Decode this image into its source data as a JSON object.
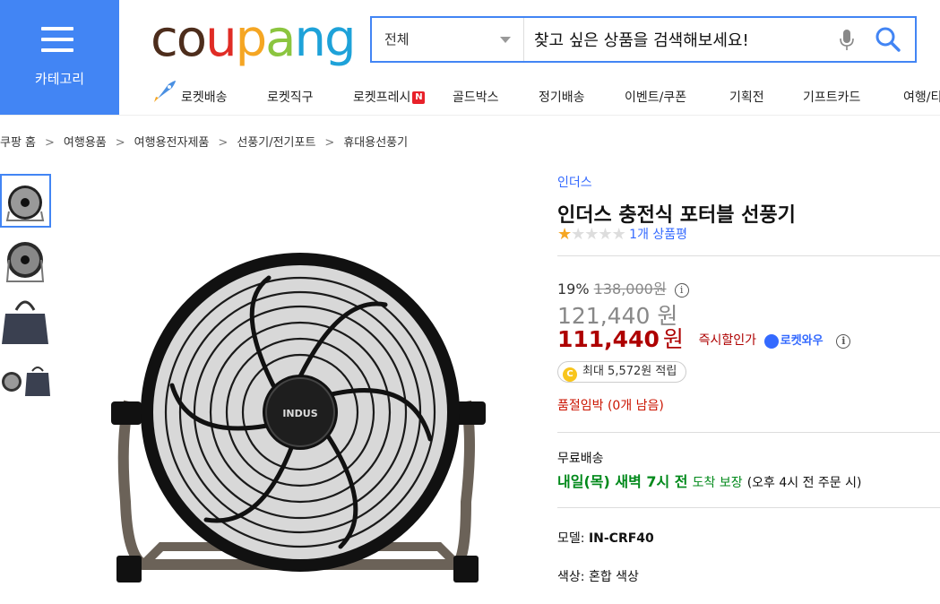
{
  "header": {
    "category_label": "카테고리",
    "logo_letters": [
      "c",
      "o",
      "u",
      "p",
      "a",
      "n",
      "g"
    ],
    "logo_colors": [
      "#4d2d1c",
      "#4d2d1c",
      "#e02c25",
      "#f5a623",
      "#8bc53f",
      "#1ea2d9",
      "#1ea2d9"
    ],
    "search": {
      "category": "전체",
      "placeholder": "찾고 싶은 상품을 검색해보세요!"
    }
  },
  "nav": {
    "items": [
      "로켓배송",
      "로켓직구",
      "로켓프레시",
      "골드박스",
      "정기배송",
      "이벤트/쿠폰",
      "기획전",
      "기프트카드",
      "여행/티"
    ],
    "fresh_badge": "N"
  },
  "breadcrumb": [
    "쿠팡 홈",
    "여행용품",
    "여행용전자제품",
    "선풍기/전기포트",
    "휴대용선풍기"
  ],
  "breadcrumb_sep": ">",
  "product": {
    "brand": "인더스",
    "title": "인더스 충전식 포터블 선풍기",
    "rating_stars": 1,
    "rating_max": 5,
    "review_text": "1개 상품평",
    "discount_rate": "19%",
    "original_price": "138,000원",
    "sale_price_value": "121,440",
    "sale_price_unit": "원",
    "instant_price_value": "111,440",
    "instant_price_unit": "원",
    "instant_label": "즉시할인가",
    "rocket_wow": "로켓와우",
    "reward_coin": "C",
    "reward_text": "최대 5,572원 적립",
    "stock_text": "품절임박 (0개 남음)",
    "shipping_label": "무료배송",
    "shipping_date": "내일(목) 새벽 7시 전",
    "shipping_guarantee": "도착 보장",
    "shipping_condition": "(오후 4시 전 주문 시)",
    "model_label": "모델:",
    "model_value": "IN-CRF40",
    "color_label": "색상:",
    "color_value": "혼합 색상",
    "fan_logo_text": "INDUS"
  },
  "colors": {
    "accent_blue": "#4285f4",
    "link_blue": "#346aff",
    "price_red": "#ae0000",
    "ship_green": "#00891a",
    "star_orange": "#f5a623"
  }
}
